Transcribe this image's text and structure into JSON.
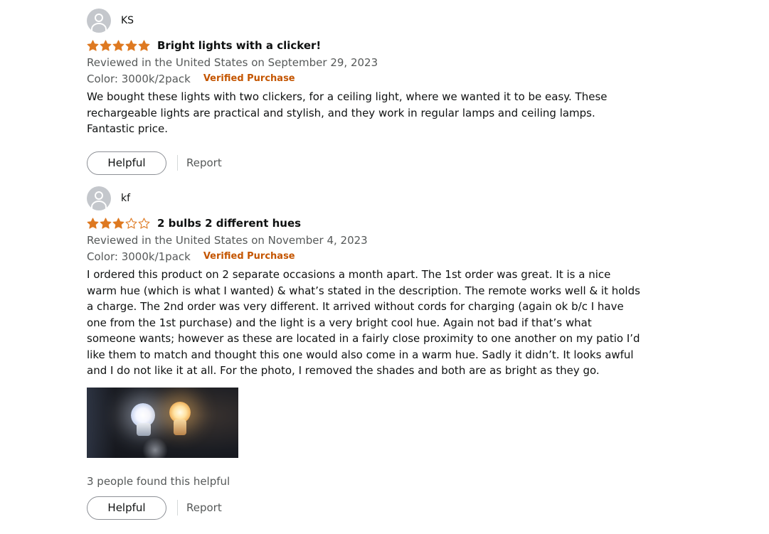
{
  "reviews": [
    {
      "profile_name": "KS",
      "rating": 5,
      "title": "Bright lights with a clicker!",
      "date": "Reviewed in the United States on September 29, 2023",
      "variant": "Color: 3000k/2pack",
      "verified": "Verified Purchase",
      "body": "We bought these lights with two clickers, for a ceiling light, where we wanted it to be easy. These rechargeable lights are practical and stylish, and they work in regular lamps and ceiling lamps. Fantastic price.",
      "helpful_label": "Helpful",
      "report_label": "Report"
    },
    {
      "profile_name": "kf",
      "rating": 3,
      "title": "2 bulbs 2 different hues",
      "date": "Reviewed in the United States on November 4, 2023",
      "variant": "Color: 3000k/1pack",
      "verified": "Verified Purchase",
      "body": "I ordered this product on 2 separate occasions a month apart. The 1st order was great. It is a nice warm hue (which is what I wanted) & what’s stated in the description. The remote works well & it holds a charge. The 2nd order was very different. It arrived without cords for charging (again ok b/c I have one from the 1st purchase) and the light is a very bright cool hue. Again not bad if that’s what someone wants; however as these are located in a fairly close proximity to one another on my patio I’d like them to match and thought this one would also come in a warm hue. Sadly it didn’t. It looks awful and I do not like it at all. For the photo, I removed the shades and both are as bright as they go.",
      "found_helpful": "3 people found this helpful",
      "helpful_label": "Helpful",
      "report_label": "Report"
    }
  ],
  "colors": {
    "star_fill": "#de7921",
    "verified": "#c45500",
    "secondary_text": "#565959"
  }
}
